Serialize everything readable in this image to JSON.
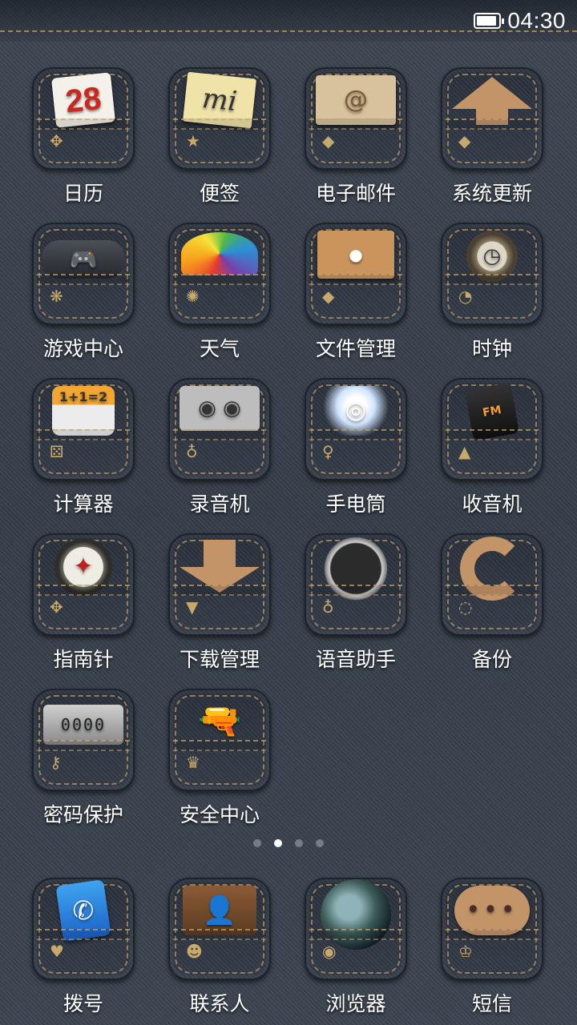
{
  "status_bar": {
    "time": "04:30",
    "battery_icon": "battery-icon",
    "battery_level": 0.9
  },
  "grid_apps": [
    {
      "label": "日历",
      "icon": "calendar-icon",
      "icon_text": "28"
    },
    {
      "label": "便签",
      "icon": "sticky-note-icon",
      "icon_text": "mi"
    },
    {
      "label": "电子邮件",
      "icon": "envelope-icon",
      "icon_text": "@"
    },
    {
      "label": "系统更新",
      "icon": "arrow-up-icon",
      "icon_text": ""
    },
    {
      "label": "游戏中心",
      "icon": "gamepad-icon",
      "icon_text": "🎮"
    },
    {
      "label": "天气",
      "icon": "umbrella-icon",
      "icon_text": ""
    },
    {
      "label": "文件管理",
      "icon": "folder-envelope-icon",
      "icon_text": ""
    },
    {
      "label": "时钟",
      "icon": "pocket-watch-icon",
      "icon_text": "🕑"
    },
    {
      "label": "计算器",
      "icon": "calculator-icon",
      "icon_text": "1+1=2"
    },
    {
      "label": "录音机",
      "icon": "cassette-icon",
      "icon_text": "◉ ◉"
    },
    {
      "label": "手电筒",
      "icon": "flashlight-icon",
      "icon_text": ""
    },
    {
      "label": "收音机",
      "icon": "radio-icon",
      "icon_text": "FM"
    },
    {
      "label": "指南针",
      "icon": "compass-icon",
      "icon_text": "✦"
    },
    {
      "label": "下载管理",
      "icon": "arrow-down-icon",
      "icon_text": ""
    },
    {
      "label": "语音助手",
      "icon": "speaker-icon",
      "icon_text": ""
    },
    {
      "label": "备份",
      "icon": "sync-arrow-icon",
      "icon_text": ""
    },
    {
      "label": "密码保护",
      "icon": "combination-lock-icon",
      "icon_text": "0000"
    },
    {
      "label": "安全中心",
      "icon": "revolver-icon",
      "icon_text": "🔫"
    }
  ],
  "page_indicator": {
    "pages": 4,
    "active": 2
  },
  "dock_apps": [
    {
      "label": "拨号",
      "icon": "phone-icon",
      "icon_text": "✆"
    },
    {
      "label": "联系人",
      "icon": "wallet-contacts-icon",
      "icon_text": "👤"
    },
    {
      "label": "浏览器",
      "icon": "globe-icon",
      "icon_text": ""
    },
    {
      "label": "短信",
      "icon": "chat-bubble-icon",
      "icon_text": "•••"
    }
  ]
}
